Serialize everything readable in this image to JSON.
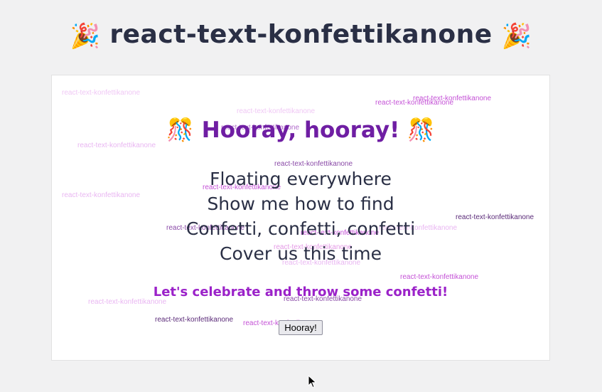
{
  "page": {
    "title": "react-text-konfettikanone",
    "title_emoji": "🎉"
  },
  "card": {
    "heading": "Hooray, hooray!",
    "heading_emoji": "🎊",
    "lyrics": [
      "Floating everywhere",
      "Show me how to find",
      "Confetti, confetti, confetti",
      "Cover us this time"
    ],
    "celebrate_text": "Let's celebrate and throw some confetti!",
    "button_label": "Hooray!"
  },
  "confetti": {
    "text": "react-text-konfettikanone",
    "colors": [
      "#f0c8f5",
      "#e9b6f2",
      "#b16acb",
      "#8a4aa7",
      "#5a2a78",
      "#c451d6",
      "#e49ae6"
    ]
  },
  "colors": {
    "title": "#2a2f45",
    "heading": "#6f1ea3",
    "celebrate": "#9b22c9",
    "background": "#f1f1f2"
  }
}
